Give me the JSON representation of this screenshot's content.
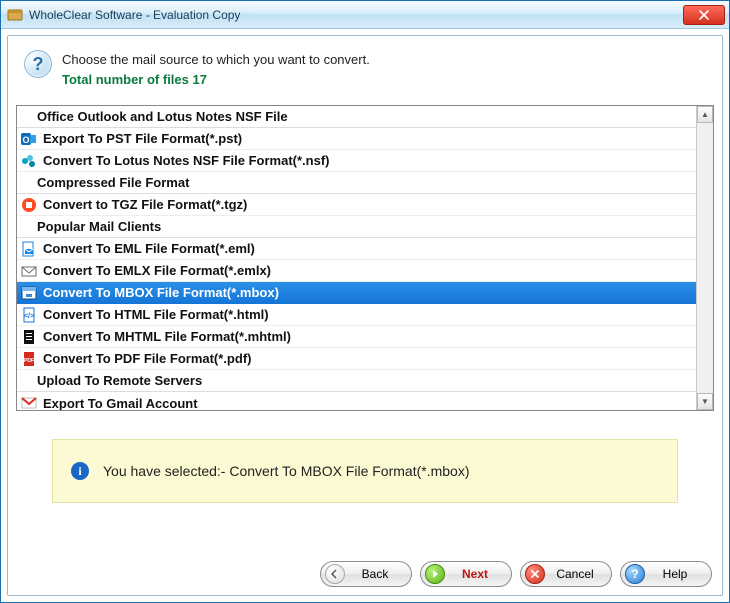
{
  "window": {
    "title": "WholeClear Software - Evaluation Copy"
  },
  "prompt": {
    "line1": "Choose the mail source to which you want to convert.",
    "line2": "Total number of files 17"
  },
  "groups": {
    "g0": "Office Outlook and Lotus Notes NSF File",
    "g1": "Compressed File Format",
    "g2": "Popular Mail Clients",
    "g3": "Upload To Remote Servers"
  },
  "items": {
    "pst": {
      "label": "Export To PST File Format(*.pst)",
      "icon": "outlook",
      "color": "#0F6CBD"
    },
    "nsf": {
      "label": "Convert To Lotus Notes NSF File Format(*.nsf)",
      "icon": "lotus",
      "color": "#00A3C7"
    },
    "tgz": {
      "label": "Convert to TGZ File Format(*.tgz)",
      "icon": "archive",
      "color": "#FF4B1F"
    },
    "eml": {
      "label": "Convert To EML File Format(*.eml)",
      "icon": "file-mail",
      "color": "#1385E5"
    },
    "emlx": {
      "label": "Convert To EMLX File Format(*.emlx)",
      "icon": "envelope",
      "color": "#6b6b6b"
    },
    "mbox": {
      "label": "Convert To MBOX File Format(*.mbox)",
      "icon": "mbox",
      "color": "#1d72d1"
    },
    "html": {
      "label": "Convert To HTML File Format(*.html)",
      "icon": "file-code",
      "color": "#1173d4"
    },
    "mhtml": {
      "label": "Convert To MHTML File Format(*.mhtml)",
      "icon": "file-dark",
      "color": "#111111"
    },
    "pdf": {
      "label": "Convert To PDF File Format(*.pdf)",
      "icon": "file-pdf",
      "color": "#D22A1E"
    },
    "gmail": {
      "label": "Export To Gmail Account",
      "icon": "gmail",
      "color": "#D93025"
    }
  },
  "selected_key": "mbox",
  "info": {
    "prefix": "You have selected:- ",
    "value": "Convert To MBOX File Format(*.mbox)"
  },
  "buttons": {
    "back": "Back",
    "next": "Next",
    "cancel": "Cancel",
    "help": "Help"
  }
}
